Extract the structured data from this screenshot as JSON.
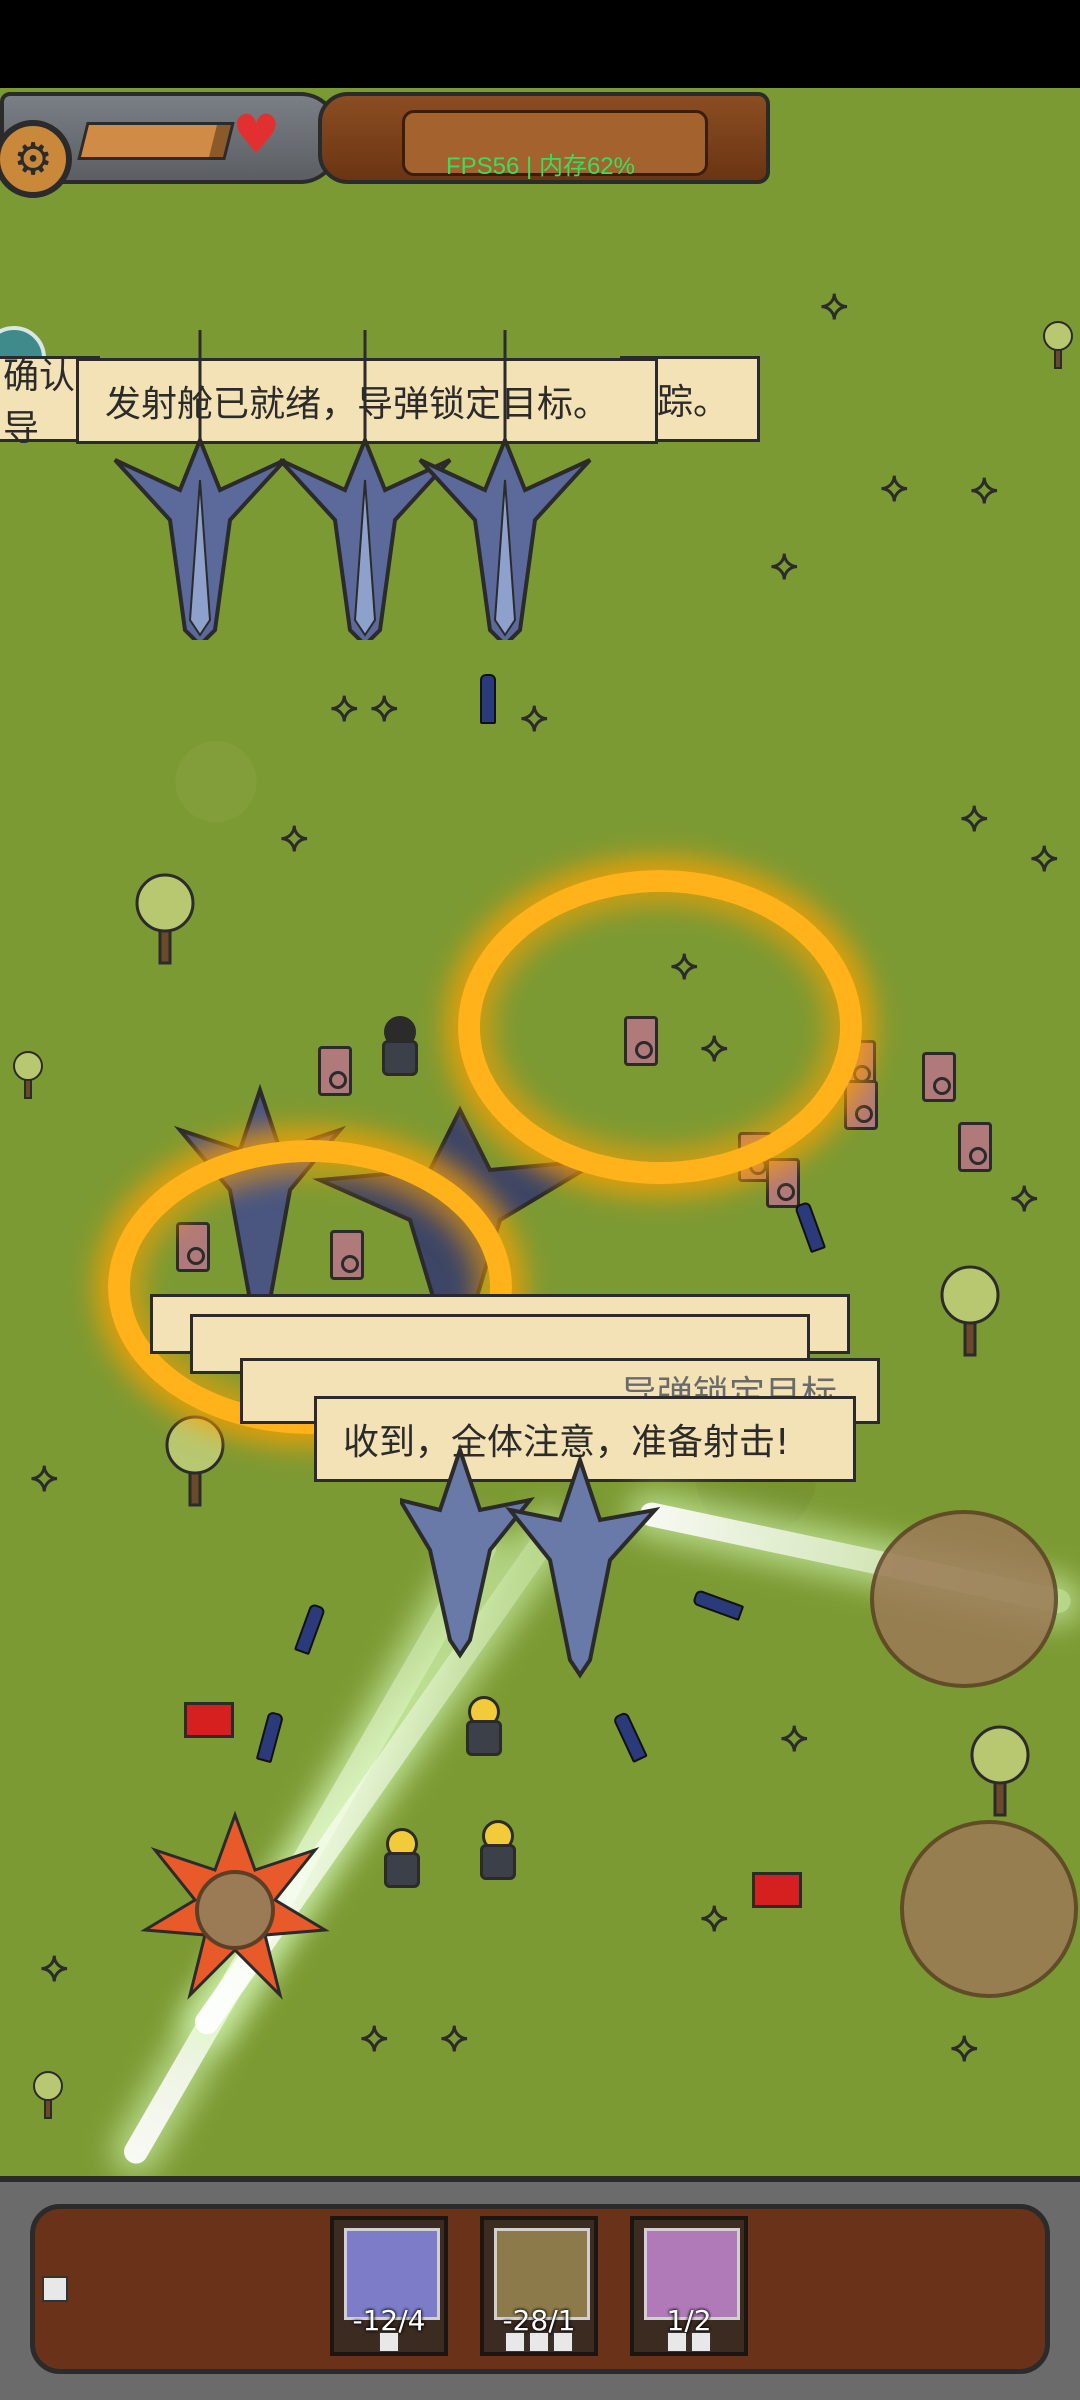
{
  "hud": {
    "fps_label": "FPS56 | 内存62%",
    "hp_fraction": 0.9,
    "settings_icon": "gear-icon",
    "life_icon": "heart-icon"
  },
  "dialogs": {
    "top_left_partial": "确认导",
    "top_main": "发射舱已就绪，导弹锁定目标。",
    "top_right_partial": "踪。",
    "middle_main": "收到，全体注意，准备射击!",
    "middle_behind": "导弹锁定目标"
  },
  "unit_cards": [
    {
      "count": "-12/4",
      "name": "speaker-unit"
    },
    {
      "count": "-28/1",
      "name": "warship-unit"
    },
    {
      "count": "1/2",
      "name": "soldier-unit"
    }
  ],
  "colors": {
    "grass": "#7c9a33",
    "ring": "#ffb21a",
    "fps": "#37e05a"
  }
}
